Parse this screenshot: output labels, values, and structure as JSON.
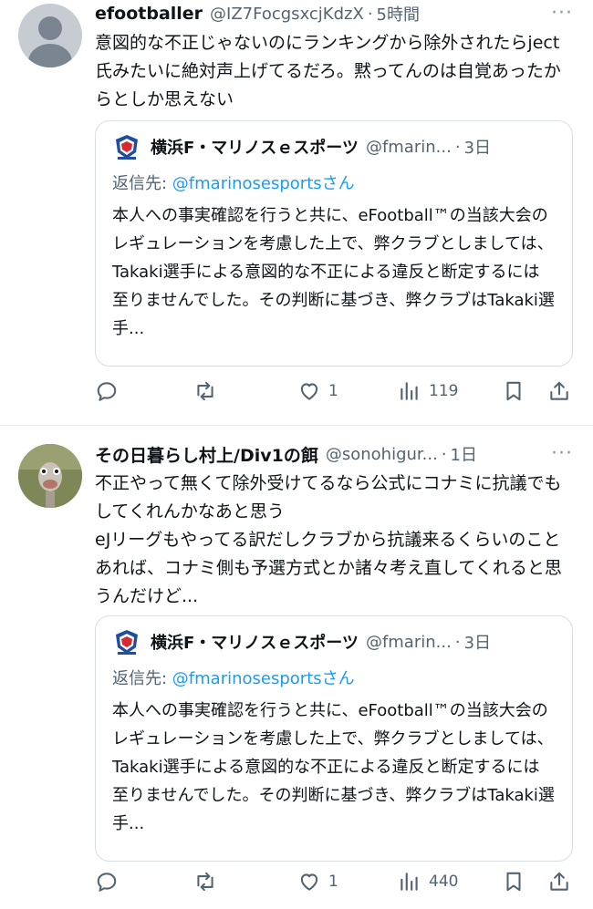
{
  "tweets": [
    {
      "author": {
        "display_name": "efootballer",
        "handle": "@IZ7FocgsxcjKdzX",
        "time": "5時間"
      },
      "text": "意図的な不正じゃないのにランキングから除外されたらject氏みたいに絶対声上げてるだろ。黙ってんのは自覚あったからとしか思えない",
      "quote": {
        "name": "横浜F・マリノスｅスポーツ",
        "handle": "@fmarin...",
        "time": "3日",
        "reply_prefix": "返信先: ",
        "reply_mention": "@fmarinosesports",
        "reply_suffix": "さん",
        "text": "本人への事実確認を行うと共に、eFootball™の当該大会のレギュレーションを考慮した上で、弊クラブとしましては、Takaki選手による意図的な不正による違反と断定するには至りませんでした。その判断に基づき、弊クラブはTakaki選手..."
      },
      "actions": {
        "replies": "",
        "retweets": "",
        "likes": "1",
        "views": "119"
      }
    },
    {
      "author": {
        "display_name": "その日暮らし村上/Div1の餌",
        "handle": "@sonohigur...",
        "time": "1日"
      },
      "text": "不正やって無くて除外受けてるなら公式にコナミに抗議でもしてくれんかなあと思う\neJリーグもやってる訳だしクラブから抗議来るくらいのことあれば、コナミ側も予選方式とか諸々考え直してくれると思うんだけど...",
      "quote": {
        "name": "横浜F・マリノスｅスポーツ",
        "handle": "@fmarin...",
        "time": "3日",
        "reply_prefix": "返信先: ",
        "reply_mention": "@fmarinosesports",
        "reply_suffix": "さん",
        "text": "本人への事実確認を行うと共に、eFootball™の当該大会のレギュレーションを考慮した上で、弊クラブとしましては、Takaki選手による意図的な不正による違反と断定するには至りませんでした。その判断に基づき、弊クラブはTakaki選手..."
      },
      "actions": {
        "replies": "",
        "retweets": "",
        "likes": "1",
        "views": "440"
      }
    }
  ],
  "ui": {
    "separator": "·",
    "more": "···",
    "icons": [
      "reply-icon",
      "retweet-icon",
      "like-icon",
      "views-icon",
      "bookmark-icon",
      "share-icon",
      "more-icon"
    ],
    "colors": {
      "text": "#0f1419",
      "secondary": "#536471",
      "link": "#1d9bf0",
      "border": "#d9dee2"
    }
  }
}
